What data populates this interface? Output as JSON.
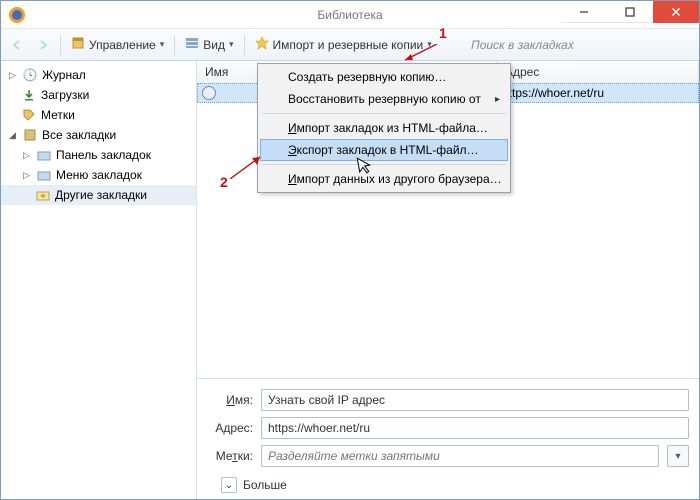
{
  "window": {
    "title": "Библиотека"
  },
  "toolbar": {
    "organize": "Управление",
    "view": "Вид",
    "import": "Импорт и резервные копии",
    "search_placeholder": "Поиск в закладках"
  },
  "tree": {
    "history": "Журнал",
    "downloads": "Загрузки",
    "tags": "Метки",
    "all_bookmarks": "Все закладки",
    "toolbar_bookmarks": "Панель закладок",
    "menu_bookmarks": "Меню закладок",
    "other_bookmarks": "Другие закладки"
  },
  "list": {
    "col_name": "Имя",
    "col_addr": "Адрес",
    "item_addr": "https://whoer.net/ru"
  },
  "menu": {
    "backup": "Создать резервную копию…",
    "restore": "Восстановить резервную копию от",
    "import_html_pre": "Импорт закладок из HTML-файла…",
    "export_html_pre": "Экспорт закладок в HTML-файл…",
    "import_browser_pre": "Импорт данных из другого браузера…"
  },
  "details": {
    "label_name": "Имя:",
    "label_addr": "Адрес:",
    "label_tags": "Метки:",
    "name_value": "Узнать свой IP адрес",
    "addr_value": "https://whoer.net/ru",
    "tags_placeholder": "Разделяйте метки запятыми",
    "more": "Больше"
  },
  "annotations": {
    "a1": "1",
    "a2": "2"
  }
}
